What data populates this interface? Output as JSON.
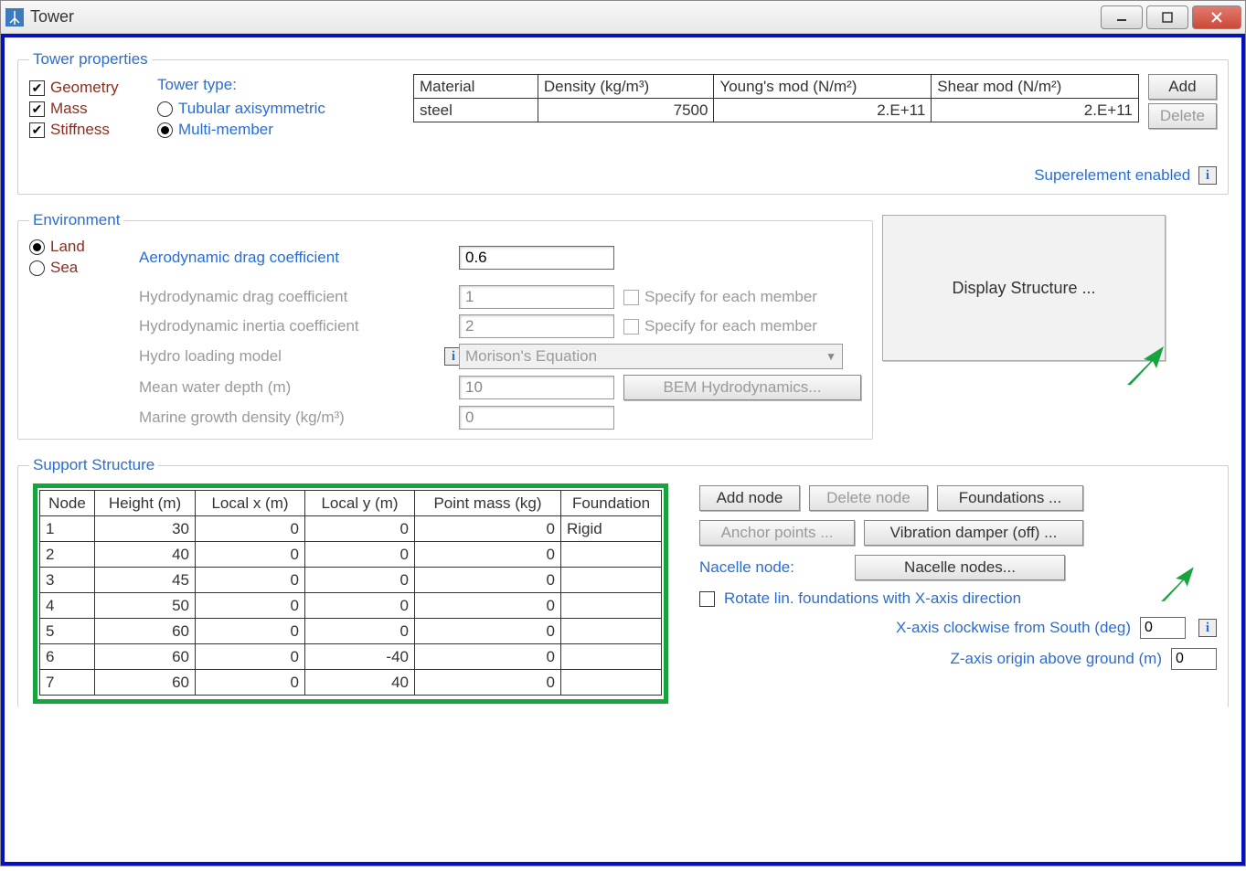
{
  "window": {
    "title": "Tower"
  },
  "tower_properties": {
    "legend": "Tower properties",
    "geometry_label": "Geometry",
    "mass_label": "Mass",
    "stiffness_label": "Stiffness",
    "tower_type_label": "Tower type:",
    "radio_tubular": "Tubular axisymmetric",
    "radio_multi": "Multi-member",
    "headers": {
      "material": "Material",
      "density": "Density (kg/m³)",
      "youngs": "Young's mod (N/m²)",
      "shear": "Shear mod (N/m²)"
    },
    "row": {
      "material": "steel",
      "density": "7500",
      "youngs": "2.E+11",
      "shear": "2.E+11"
    },
    "add_btn": "Add",
    "delete_btn": "Delete",
    "superelement": "Superelement enabled"
  },
  "environment": {
    "legend": "Environment",
    "land_label": "Land",
    "sea_label": "Sea",
    "aero_drag_label": "Aerodynamic drag coefficient",
    "aero_drag_value": "0.6",
    "hydro_drag_label": "Hydrodynamic drag coefficient",
    "hydro_drag_value": "1",
    "hydro_inertia_label": "Hydrodynamic inertia coefficient",
    "hydro_inertia_value": "2",
    "specify_member": "Specify for each member",
    "hydro_loading_label": "Hydro loading model",
    "hydro_loading_value": "Morison's Equation",
    "mean_depth_label": "Mean water depth (m)",
    "mean_depth_value": "10",
    "marine_growth_label": "Marine growth density  (kg/m³)",
    "marine_growth_value": "0",
    "bem_btn": "BEM Hydrodynamics...",
    "display_structure_btn": "Display Structure ..."
  },
  "support": {
    "legend": "Support Structure",
    "headers": {
      "node": "Node",
      "height": "Height (m)",
      "localx": "Local x (m)",
      "localy": "Local y (m)",
      "pointmass": "Point mass (kg)",
      "foundation": "Foundation"
    },
    "rows": [
      {
        "node": "1",
        "height": "30",
        "lx": "0",
        "ly": "0",
        "pm": "0",
        "fdn": "Rigid"
      },
      {
        "node": "2",
        "height": "40",
        "lx": "0",
        "ly": "0",
        "pm": "0",
        "fdn": ""
      },
      {
        "node": "3",
        "height": "45",
        "lx": "0",
        "ly": "0",
        "pm": "0",
        "fdn": ""
      },
      {
        "node": "4",
        "height": "50",
        "lx": "0",
        "ly": "0",
        "pm": "0",
        "fdn": ""
      },
      {
        "node": "5",
        "height": "60",
        "lx": "0",
        "ly": "0",
        "pm": "0",
        "fdn": ""
      },
      {
        "node": "6",
        "height": "60",
        "lx": "0",
        "ly": "-40",
        "pm": "0",
        "fdn": ""
      },
      {
        "node": "7",
        "height": "60",
        "lx": "0",
        "ly": "40",
        "pm": "0",
        "fdn": ""
      }
    ],
    "add_node_btn": "Add node",
    "delete_node_btn": "Delete node",
    "foundations_btn": "Foundations ...",
    "anchor_btn": "Anchor points ...",
    "vibration_btn": "Vibration damper (off) ...",
    "nacelle_label": "Nacelle node:",
    "nacelle_btn": "Nacelle nodes...",
    "rotate_label": "Rotate lin. foundations with X-axis direction",
    "xaxis_label": "X-axis clockwise from South (deg)",
    "xaxis_value": "0",
    "zaxis_label": "Z-axis origin above ground (m)",
    "zaxis_value": "0"
  }
}
